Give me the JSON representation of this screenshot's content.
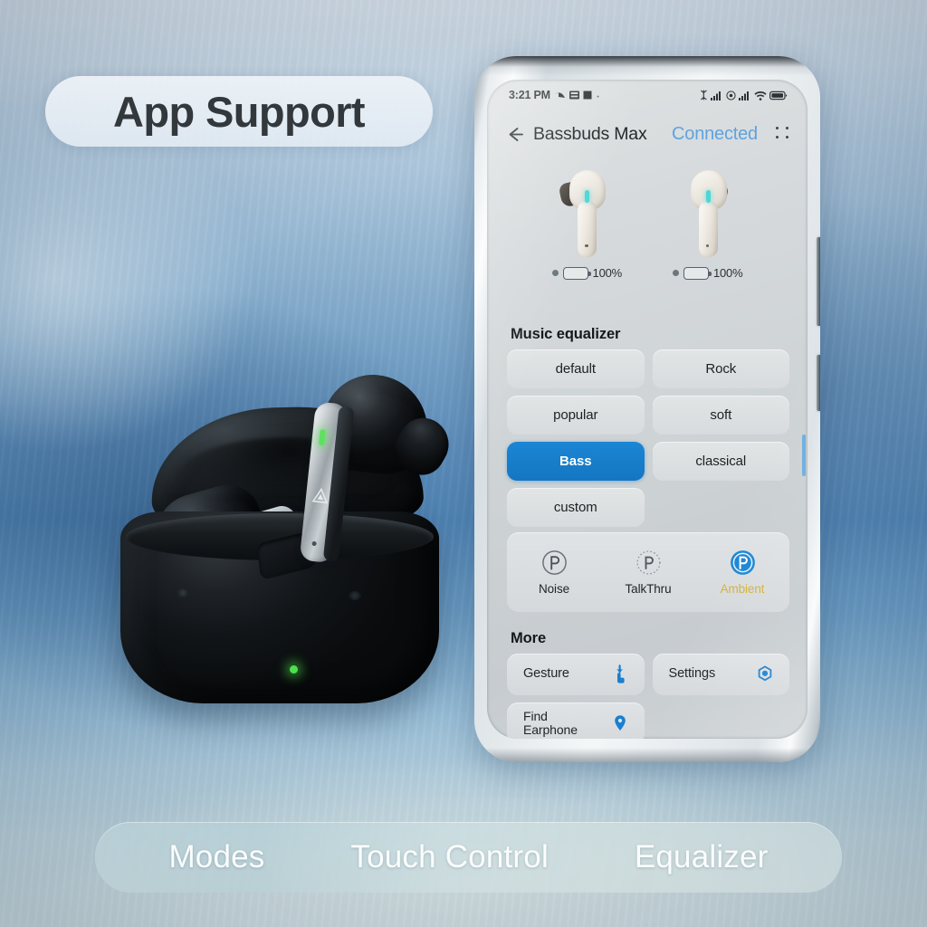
{
  "banner": {
    "title": "App Support"
  },
  "features": [
    {
      "label": "Modes"
    },
    {
      "label": "Touch Control"
    },
    {
      "label": "Equalizer"
    }
  ],
  "phone": {
    "statusbar": {
      "time": "3:21 PM",
      "left_icons": [
        "back-arrow-notification-icon",
        "keyboard-icon",
        "square-icon"
      ],
      "right_icons": [
        "bluetooth-icon",
        "signal-bars-icon",
        "nfc-icon",
        "signal-bars-icon",
        "wifi-icon",
        "battery-icon"
      ]
    },
    "titlebar": {
      "back_icon": "back-arrow-icon",
      "device_name": "Bassbuds Max",
      "status": "Connected",
      "status_color": "#5ea3de",
      "menu_icon": "four-dot-menu-icon"
    },
    "earbuds": [
      {
        "side": "left",
        "battery": "100%",
        "battery_level": 100
      },
      {
        "side": "right",
        "battery": "100%",
        "battery_level": 100
      }
    ],
    "equalizer": {
      "heading": "Music equalizer",
      "selected": "Bass",
      "accent": "#1476c2",
      "presets": [
        {
          "label": "default",
          "selected": false
        },
        {
          "label": "Rock",
          "selected": false
        },
        {
          "label": "popular",
          "selected": false
        },
        {
          "label": "soft",
          "selected": false
        },
        {
          "label": "Bass",
          "selected": true
        },
        {
          "label": "classical",
          "selected": false
        },
        {
          "label": "custom",
          "selected": false
        }
      ]
    },
    "modes": {
      "active": "Ambient",
      "active_color": "#d4b13c",
      "items": [
        {
          "label": "Noise",
          "icon": "noise-cancel-icon",
          "active": false
        },
        {
          "label": "TalkThru",
          "icon": "talkthru-icon",
          "active": false
        },
        {
          "label": "Ambient",
          "icon": "ambient-sound-icon",
          "active": true
        }
      ]
    },
    "more": {
      "heading": "More",
      "items": [
        {
          "label": "Gesture",
          "icon": "tap-hand-icon"
        },
        {
          "label": "Settings",
          "icon": "gear-hex-icon"
        },
        {
          "label": "Find Earphone",
          "label_line1": "Find",
          "label_line2": "Earphone",
          "icon": "location-pin-icon"
        }
      ]
    }
  },
  "product": {
    "name": "wireless-earbuds-charging-case",
    "case_led_color": "#4ce04c",
    "bud_led_color": "#5fe05f"
  }
}
